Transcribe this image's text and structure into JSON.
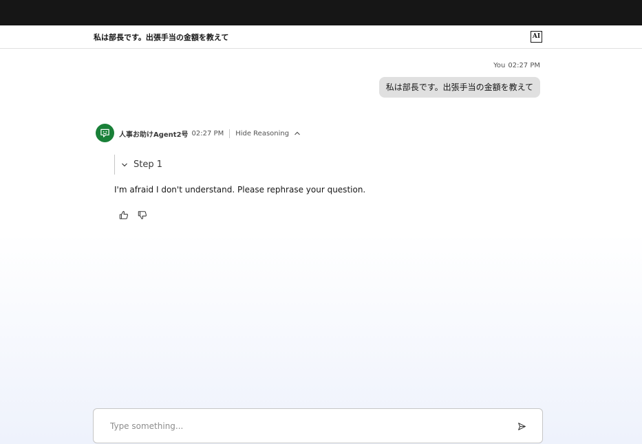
{
  "header": {
    "title": "私は部長です。出張手当の金額を教えて",
    "badge": "AI"
  },
  "user_message": {
    "sender": "You",
    "time": "02:27 PM",
    "text": "私は部長です。出張手当の金額を教えて"
  },
  "agent_message": {
    "name": "人事お助けAgent2号",
    "time": "02:27 PM",
    "reasoning_toggle": "Hide Reasoning",
    "step_label": "Step 1",
    "text": "I'm afraid I don't understand. Please rephrase your question.",
    "avatar_color": "#198038"
  },
  "feedback": {
    "like_icon": "thumbs-up-icon",
    "dislike_icon": "thumbs-down-icon"
  },
  "composer": {
    "placeholder": "Type something...",
    "value": "",
    "send_icon": "send-icon"
  },
  "colors": {
    "topbar": "#161616",
    "user_bubble": "#e0e0e0",
    "agent_avatar": "#198038"
  }
}
